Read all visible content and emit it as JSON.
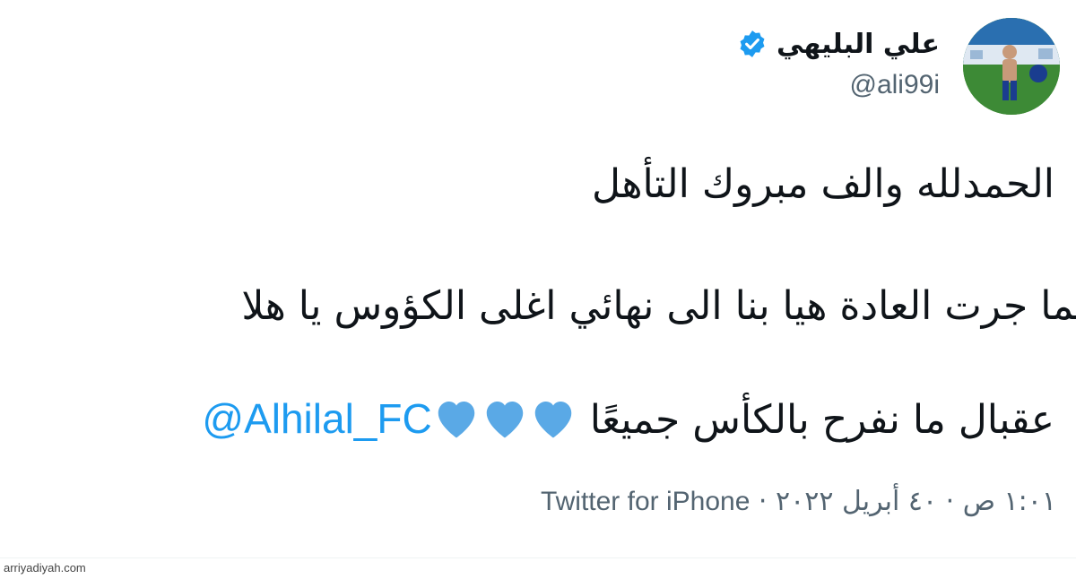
{
  "author": {
    "display_name": "علي البليهي",
    "handle": "@ali99i",
    "verified": true
  },
  "tweet": {
    "line1": "الحمدلله والف مبروك التأهل",
    "line2": "كما جرت العادة هيا بنا الى نهائي اغلى الكؤوس يا هلا",
    "line3_text": "عقبال ما نفرح بالكأس جميعًا",
    "line3_mention": "@Alhilal_FC",
    "heart_count": 3
  },
  "meta": {
    "time": "١:٠١ ص",
    "date": "٤٠ أبريل ٢٠٢٢",
    "separator": "·",
    "source": "Twitter for iPhone"
  },
  "watermark": "arriyadiyah.com",
  "colors": {
    "link": "#1d9bf0",
    "verified": "#1d9bf0",
    "heart": "#5aa9e6",
    "secondary_text": "#536471"
  },
  "icons": {
    "verified": "verified-badge-icon",
    "heart": "blue-heart-icon"
  }
}
